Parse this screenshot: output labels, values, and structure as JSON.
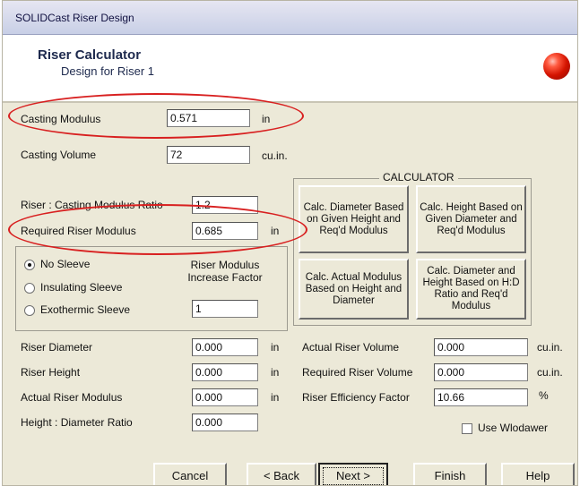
{
  "window": {
    "title": "SOLIDCast Riser Design"
  },
  "header": {
    "title": "Riser Calculator",
    "subtitle": "Design for Riser 1"
  },
  "casting": {
    "modulus_label": "Casting Modulus",
    "modulus_value": "0.571",
    "modulus_unit": "in",
    "volume_label": "Casting Volume",
    "volume_value": "72",
    "volume_unit": "cu.in."
  },
  "riser": {
    "ratio_label": "Riser : Casting Modulus Ratio",
    "ratio_value": "1.2",
    "required_label": "Required Riser Modulus",
    "required_value": "0.685",
    "required_unit": "in"
  },
  "sleeve": {
    "options": [
      "No Sleeve",
      "Insulating Sleeve",
      "Exothermic Sleeve"
    ],
    "selected": "No Sleeve",
    "factor_label": "Riser Modulus Increase Factor",
    "factor_value": "1"
  },
  "calculator": {
    "title": "CALCULATOR",
    "buttons": [
      "Calc. Diameter Based on Given Height and Req'd Modulus",
      "Calc. Height Based on Given Diameter and Req'd Modulus",
      "Calc. Actual Modulus Based on Height and Diameter",
      "Calc. Diameter and Height Based on H:D Ratio and Req'd Modulus"
    ]
  },
  "results_left": [
    {
      "label": "Riser Diameter",
      "value": "0.000",
      "unit": "in"
    },
    {
      "label": "Riser Height",
      "value": "0.000",
      "unit": "in"
    },
    {
      "label": "Actual Riser Modulus",
      "value": "0.000",
      "unit": "in"
    },
    {
      "label": "Height : Diameter Ratio",
      "value": "0.000",
      "unit": ""
    }
  ],
  "results_right": [
    {
      "label": "Actual Riser Volume",
      "value": "0.000",
      "unit": "cu.in."
    },
    {
      "label": "Required Riser Volume",
      "value": "0.000",
      "unit": "cu.in."
    },
    {
      "label": "Riser Efficiency Factor",
      "value": "10.66",
      "unit": "%"
    }
  ],
  "use_wlodawer": {
    "label": "Use Wlodawer",
    "checked": false
  },
  "nav": {
    "cancel": "Cancel",
    "back": "< Back",
    "next": "Next >",
    "finish": "Finish",
    "help": "Help"
  },
  "colors": {
    "annotation": "#d82020",
    "dialog_bg": "#ece9d8",
    "orb": "#d41400"
  }
}
